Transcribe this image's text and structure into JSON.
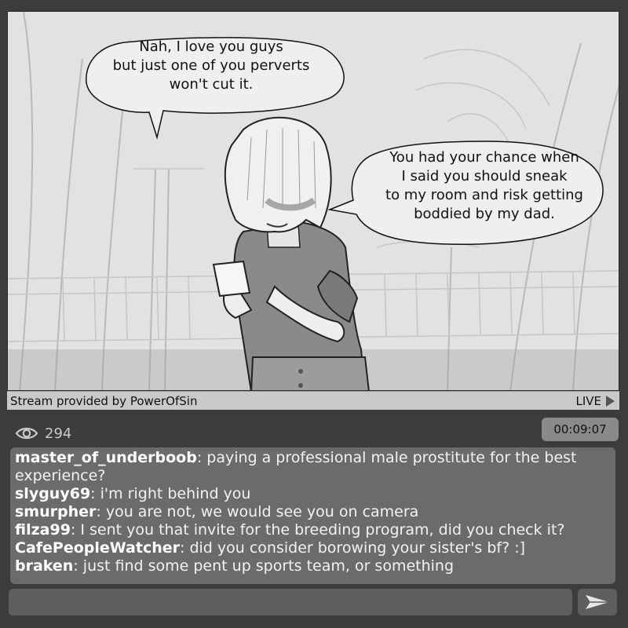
{
  "video": {
    "bubble_left": "Nah, I love you guys\nbut just one of you perverts\nwon't cut it.",
    "bubble_right": "You had your chance when\nI said you should sneak\nto my room and risk getting\nboddied by my dad."
  },
  "stream_bar": {
    "provider": "Stream provided by PowerOfSin",
    "live_label": "LIVE",
    "live_icon": "play-triangle-icon"
  },
  "viewers": {
    "icon": "eye-icon",
    "count": "294"
  },
  "timer": "00:09:07",
  "chat": {
    "messages": [
      {
        "user": "master_of_underboob",
        "text": ": paying a professional male prostitute for the best experience?"
      },
      {
        "user": "slyguy69",
        "text": ": i'm right behind you"
      },
      {
        "user": "smurpher",
        "text": ": you are not, we would see you on camera"
      },
      {
        "user": "filza99",
        "text": ": I sent you that invite for the breeding program, did you check it?"
      },
      {
        "user": "CafePeopleWatcher",
        "text": ": did you consider borowing your sister's bf? :]"
      },
      {
        "user": "braken",
        "text": ": just find some pent up sports team, or something"
      }
    ]
  },
  "input": {
    "value": "",
    "send_icon": "send-arrow-icon"
  },
  "colors": {
    "background": "#3c3c3c",
    "chat_bg": "#6b6b6b",
    "timer_bg": "#8a8a8a",
    "stream_bar_bg": "#c9c9c9"
  }
}
